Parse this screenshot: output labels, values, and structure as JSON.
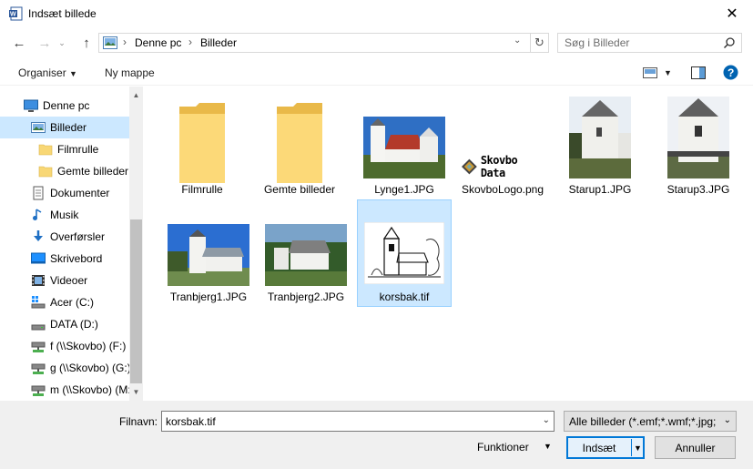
{
  "window": {
    "title": "Indsæt billede"
  },
  "nav": {
    "breadcrumb": [
      "Denne pc",
      "Billeder"
    ],
    "search_placeholder": "Søg i Billeder"
  },
  "toolbar": {
    "organize": "Organiser",
    "new_folder": "Ny mappe"
  },
  "sidebar": {
    "items": [
      {
        "label": "Denne pc",
        "icon": "pc-icon"
      },
      {
        "label": "Billeder",
        "icon": "pictures-icon",
        "selected": true
      },
      {
        "label": "Filmrulle",
        "icon": "folder-icon"
      },
      {
        "label": "Gemte billeder",
        "icon": "folder-icon"
      },
      {
        "label": "Dokumenter",
        "icon": "document-icon"
      },
      {
        "label": "Musik",
        "icon": "music-icon"
      },
      {
        "label": "Overførsler",
        "icon": "download-icon"
      },
      {
        "label": "Skrivebord",
        "icon": "desktop-icon"
      },
      {
        "label": "Videoer",
        "icon": "video-icon"
      },
      {
        "label": "Acer (C:)",
        "icon": "drive-os-icon"
      },
      {
        "label": "DATA (D:)",
        "icon": "drive-icon"
      },
      {
        "label": "f (\\\\Skovbo) (F:)",
        "icon": "network-drive-icon"
      },
      {
        "label": "g (\\\\Skovbo) (G:)",
        "icon": "network-drive-icon"
      },
      {
        "label": "m (\\\\Skovbo) (M:)",
        "icon": "network-drive-icon"
      }
    ]
  },
  "files": [
    {
      "name": "Filmrulle",
      "kind": "folder"
    },
    {
      "name": "Gemte billeder",
      "kind": "folder"
    },
    {
      "name": "Lynge1.JPG",
      "kind": "photo"
    },
    {
      "name": "SkovboLogo.png",
      "kind": "logo",
      "logo_text": "Skovbo Data"
    },
    {
      "name": "Starup1.JPG",
      "kind": "photo"
    },
    {
      "name": "Starup3.JPG",
      "kind": "photo"
    },
    {
      "name": "Tranbjerg1.JPG",
      "kind": "photo"
    },
    {
      "name": "Tranbjerg2.JPG",
      "kind": "photo"
    },
    {
      "name": "korsbak.tif",
      "kind": "drawing",
      "selected": true
    }
  ],
  "footer": {
    "filename_label": "Filnavn:",
    "filename_value": "korsbak.tif",
    "filter": "Alle billeder (*.emf;*.wmf;*.jpg;",
    "tools": "Funktioner",
    "ok": "Indsæt",
    "cancel": "Annuller"
  },
  "colors": {
    "selection": "#cce8ff",
    "accent": "#0078d7",
    "folder": "#f8d775"
  }
}
